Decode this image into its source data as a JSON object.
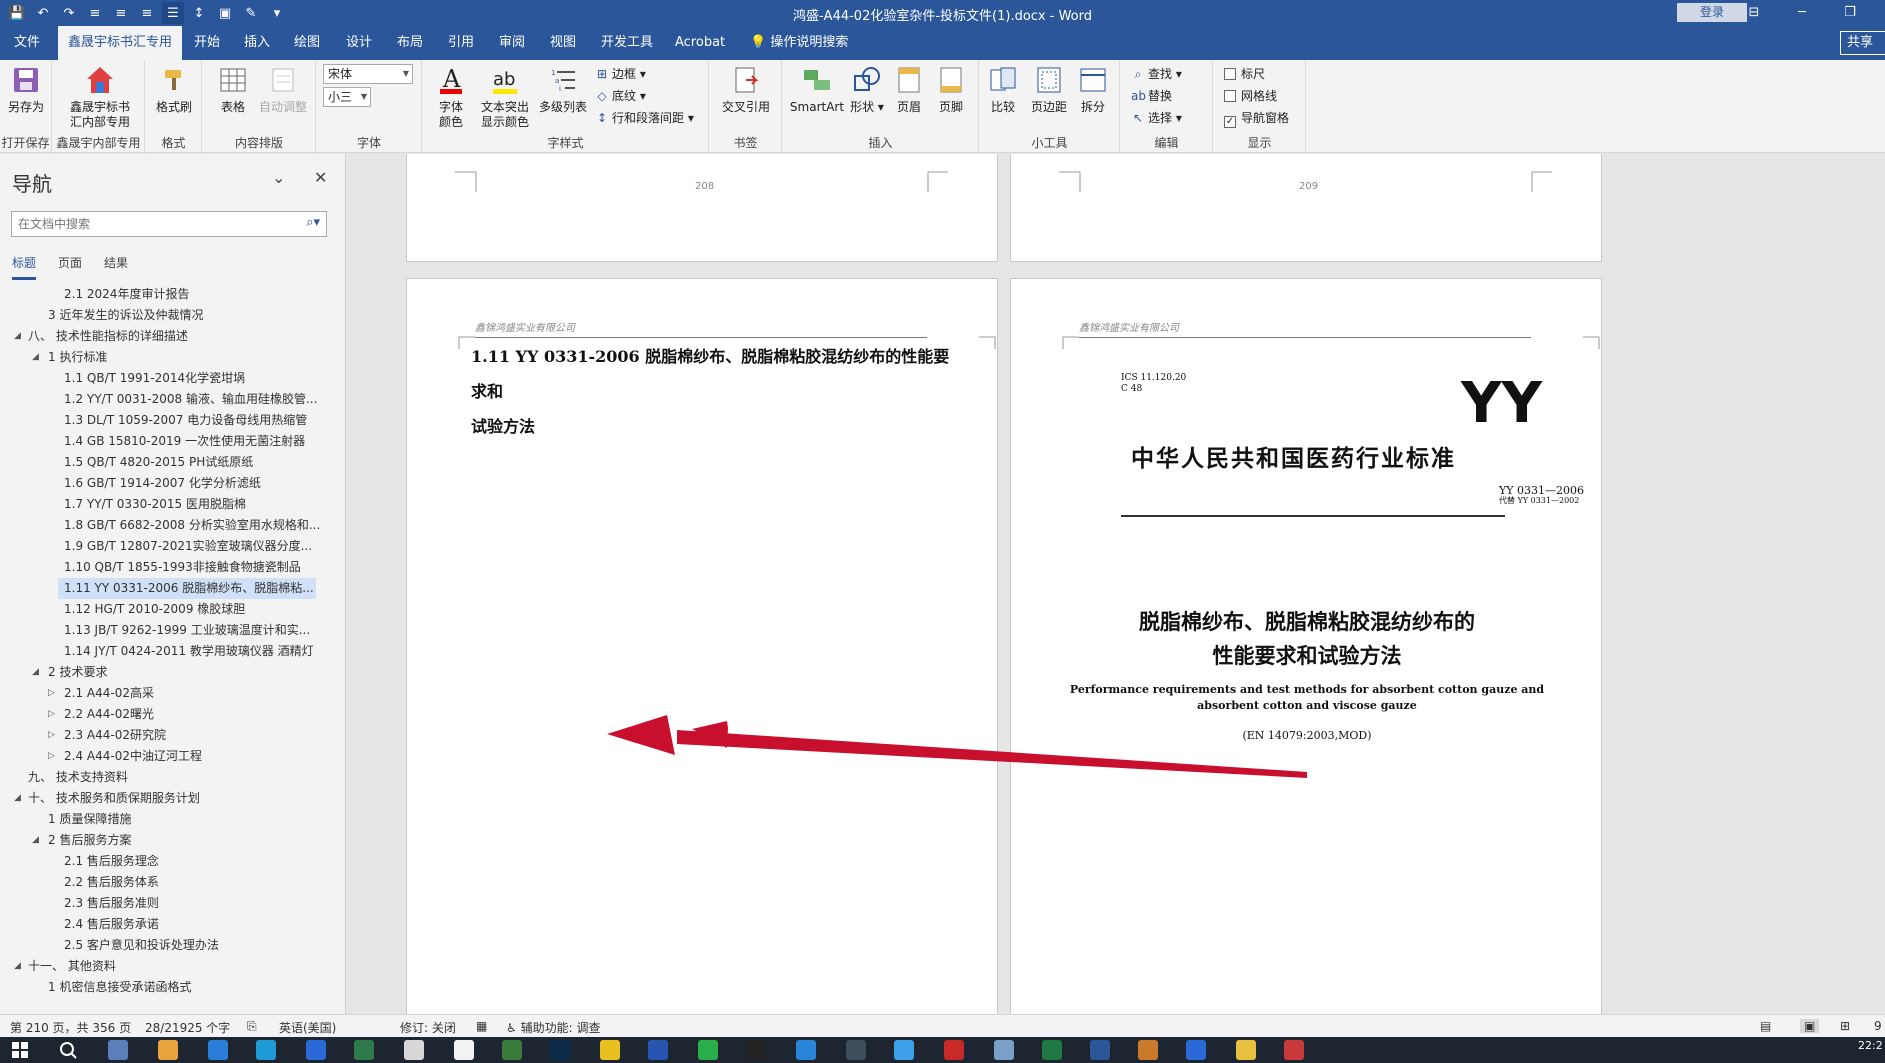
{
  "titlebar": {
    "title": "鸿盛-A44-02化验室杂件-投标文件(1).docx  -  Word",
    "login": "登录",
    "qat_icons": [
      "save-icon",
      "undo-icon",
      "redo-icon",
      "align-left-icon",
      "align-center-icon",
      "align-right-icon",
      "justify-icon",
      "line-spacing-icon",
      "save-as-icon",
      "format-painter-icon",
      "customize-icon"
    ]
  },
  "tabs": [
    "文件",
    "鑫晟宇标书汇专用",
    "开始",
    "插入",
    "绘图",
    "设计",
    "布局",
    "引用",
    "审阅",
    "视图",
    "开发工具",
    "Acrobat"
  ],
  "tell_me": "操作说明搜索",
  "share": "共享",
  "ribbon": {
    "save_as": "另存为",
    "g_open_save": "打开保存",
    "xsy_btn": "鑫晟宇标书汇内部专用",
    "g_xsy": "鑫晟宇内部专用",
    "format_painter": "格式刷",
    "g_format": "格式",
    "table": "表格",
    "auto_adjust": "自动调整",
    "g_content": "内容排版",
    "font_name": "宋体",
    "font_size": "小三",
    "g_font": "字体",
    "font_color": "字体颜色",
    "highlight": "文本突出显示颜色",
    "multilevel": "多级列表",
    "border": "边框",
    "shading": "底纹",
    "para_spacing": "行和段落间距",
    "g_style": "字样式",
    "cross_ref": "交叉引用",
    "g_bookmark": "书签",
    "smartart": "SmartArt",
    "shape": "形状",
    "header": "页眉",
    "footer": "页脚",
    "g_insert": "插入",
    "compare": "比较",
    "margins": "页边距",
    "split": "拆分",
    "g_tools": "小工具",
    "find": "查找",
    "replace": "替换",
    "select": "选择",
    "g_edit": "编辑",
    "ruler": "标尺",
    "gridlines": "网格线",
    "nav_pane": "导航窗格",
    "g_show": "显示"
  },
  "nav": {
    "title": "导航",
    "search_placeholder": "在文档中搜索",
    "tabs": [
      "标题",
      "页面",
      "结果"
    ],
    "items": [
      {
        "text": "2.1 2024年度审计报告",
        "level": 3,
        "toggle": "",
        "selected": false
      },
      {
        "text": "3 近年发生的诉讼及仲裁情况",
        "level": 2,
        "toggle": "",
        "selected": false
      },
      {
        "text": "八、 技术性能指标的详细描述",
        "level": 1,
        "toggle": "▲",
        "selected": false
      },
      {
        "text": "1 执行标准",
        "level": 2,
        "toggle": "▲",
        "selected": false
      },
      {
        "text": "1.1 QB/T 1991-2014化学瓷坩埚",
        "level": 3,
        "toggle": "",
        "selected": false
      },
      {
        "text": "1.2 YY/T 0031-2008 输液、输血用硅橡胶管...",
        "level": 3,
        "toggle": "",
        "selected": false
      },
      {
        "text": "1.3 DL/T 1059-2007 电力设备母线用热缩管",
        "level": 3,
        "toggle": "",
        "selected": false
      },
      {
        "text": "1.4 GB 15810-2019 一次性使用无菌注射器",
        "level": 3,
        "toggle": "",
        "selected": false
      },
      {
        "text": "1.5 QB/T 4820-2015 PH试纸原纸",
        "level": 3,
        "toggle": "",
        "selected": false
      },
      {
        "text": "1.6 GB/T 1914-2007 化学分析滤纸",
        "level": 3,
        "toggle": "",
        "selected": false
      },
      {
        "text": "1.7 YY/T 0330-2015 医用脱脂棉",
        "level": 3,
        "toggle": "",
        "selected": false
      },
      {
        "text": "1.8 GB/T 6682-2008 分析实验室用水规格和...",
        "level": 3,
        "toggle": "",
        "selected": false
      },
      {
        "text": "1.9 GB/T 12807-2021实验室玻璃仪器分度...",
        "level": 3,
        "toggle": "",
        "selected": false
      },
      {
        "text": "1.10 QB/T 1855-1993非接触食物搪瓷制品",
        "level": 3,
        "toggle": "",
        "selected": false
      },
      {
        "text": "1.11 YY 0331-2006 脱脂棉纱布、脱脂棉粘...",
        "level": 3,
        "toggle": "",
        "selected": true
      },
      {
        "text": "1.12 HG/T 2010-2009 橡胶球胆",
        "level": 3,
        "toggle": "",
        "selected": false
      },
      {
        "text": "1.13 JB/T 9262-1999 工业玻璃温度计和实...",
        "level": 3,
        "toggle": "",
        "selected": false
      },
      {
        "text": "1.14 JY/T 0424-2011 教学用玻璃仪器 酒精灯",
        "level": 3,
        "toggle": "",
        "selected": false
      },
      {
        "text": "2 技术要求",
        "level": 2,
        "toggle": "▲",
        "selected": false
      },
      {
        "text": "2.1 A44-02高采",
        "level": 3,
        "toggle": "▷",
        "selected": false
      },
      {
        "text": "2.2 A44-02曙光",
        "level": 3,
        "toggle": "▷",
        "selected": false
      },
      {
        "text": "2.3 A44-02研究院",
        "level": 3,
        "toggle": "▷",
        "selected": false
      },
      {
        "text": "2.4 A44-02中油辽河工程",
        "level": 3,
        "toggle": "▷",
        "selected": false
      },
      {
        "text": "九、 技术支持资料",
        "level": 1,
        "toggle": "",
        "selected": false
      },
      {
        "text": "十、 技术服务和质保期服务计划",
        "level": 1,
        "toggle": "▲",
        "selected": false
      },
      {
        "text": "1 质量保障措施",
        "level": 2,
        "toggle": "",
        "selected": false
      },
      {
        "text": "2 售后服务方案",
        "level": 2,
        "toggle": "▲",
        "selected": false
      },
      {
        "text": "2.1 售后服务理念",
        "level": 3,
        "toggle": "",
        "selected": false
      },
      {
        "text": "2.2 售后服务体系",
        "level": 3,
        "toggle": "",
        "selected": false
      },
      {
        "text": "2.3 售后服务准则",
        "level": 3,
        "toggle": "",
        "selected": false
      },
      {
        "text": "2.4 售后服务承诺",
        "level": 3,
        "toggle": "",
        "selected": false
      },
      {
        "text": "2.5 客户意见和投诉处理办法",
        "level": 3,
        "toggle": "",
        "selected": false
      },
      {
        "text": "十一、 其他资料",
        "level": 1,
        "toggle": "▲",
        "selected": false
      },
      {
        "text": "1 机密信息接受承诺函格式",
        "level": 2,
        "toggle": "",
        "selected": false
      }
    ]
  },
  "doc": {
    "page_num_left": "208",
    "page_num_right": "209",
    "header_company": "鑫锦鸿盛实业有限公司",
    "heading_line1": "1.11  YY 0331-2006 脱脂棉纱布、脱脂棉粘胶混纺纱布的性能要求和",
    "heading_line2": "试验方法",
    "std": {
      "ics": "ICS 11.120.20",
      "ccs": "C 48",
      "logo": "YY",
      "title": "中华人民共和国医药行业标准",
      "code": "YY 0331—2006",
      "replaces": "代替 YY 0331—2002",
      "cn_title_1": "脱脂棉纱布、脱脂棉粘胶混纺纱布的",
      "cn_title_2": "性能要求和试验方法",
      "en_title_1": "Performance requirements and test methods for absorbent cotton gauze and",
      "en_title_2": "absorbent cotton and viscose gauze",
      "equiv": "(EN 14079:2003,MOD)"
    },
    "arrow_color": "#c8102e"
  },
  "status": {
    "page": "第 210 页，共 356 页",
    "words": "28/21925 个字",
    "lang": "英语(美国)",
    "track": "修订: 关闭",
    "access": "辅助功能: 调查",
    "zoom": "9"
  },
  "taskbar": {
    "clock": "22:2"
  },
  "colors": {
    "word_blue": "#2b579a",
    "ribbon_bg": "#f3f3f3",
    "selection": "#cfe0f7"
  }
}
